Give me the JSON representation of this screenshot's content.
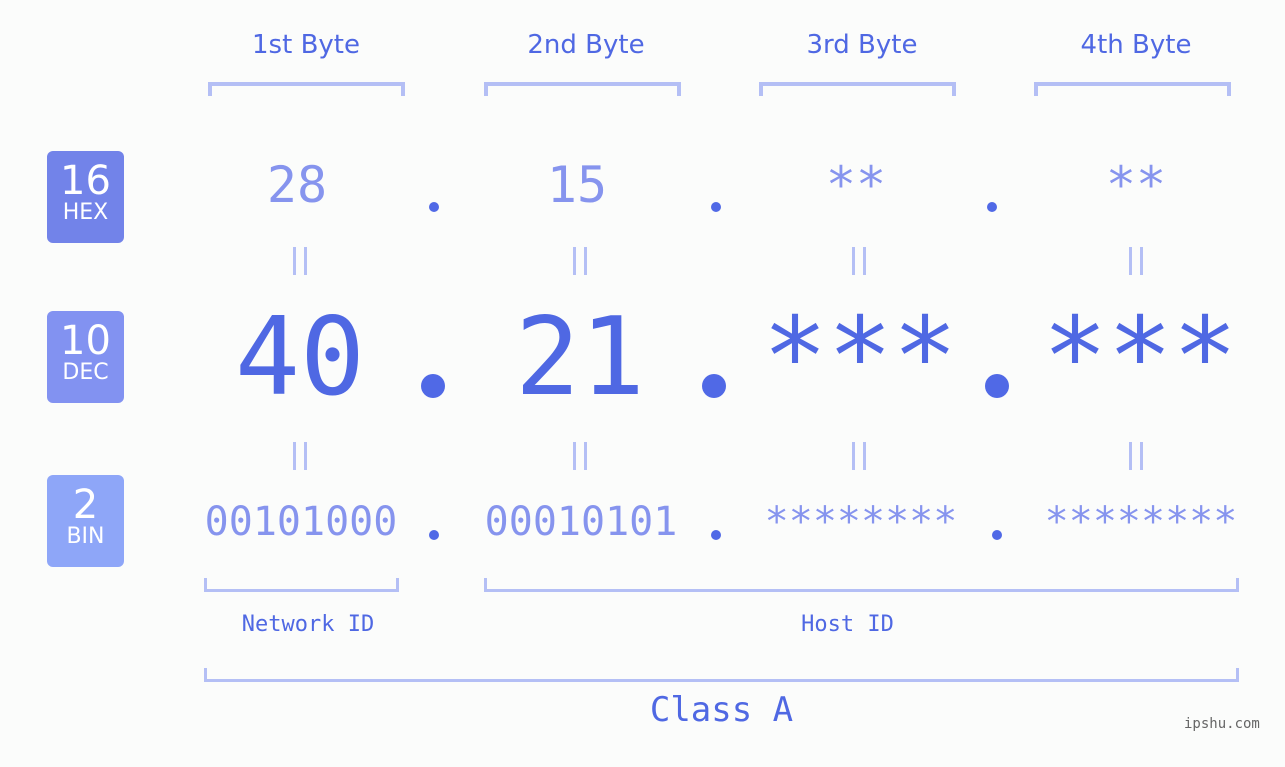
{
  "headers": [
    "1st Byte",
    "2nd Byte",
    "3rd Byte",
    "4th Byte"
  ],
  "badges": [
    {
      "num": "16",
      "label": "HEX",
      "color": "#7283e9"
    },
    {
      "num": "10",
      "label": "DEC",
      "color": "#8292f1"
    },
    {
      "num": "2",
      "label": "BIN",
      "color": "#8ea6f8"
    }
  ],
  "hex": [
    "28",
    "15",
    "**",
    "**"
  ],
  "dec": [
    "40",
    "21",
    "***",
    "***"
  ],
  "bin": [
    "00101000",
    "00010101",
    "********",
    "********"
  ],
  "separator": ".",
  "network_id_label": "Network ID",
  "host_id_label": "Host ID",
  "class_label": "Class A",
  "watermark": "ipshu.com",
  "colors": {
    "accent": "#4f68e3",
    "light": "#8694ee",
    "bracket": "#b4bff5",
    "background": "#fbfcfb"
  }
}
